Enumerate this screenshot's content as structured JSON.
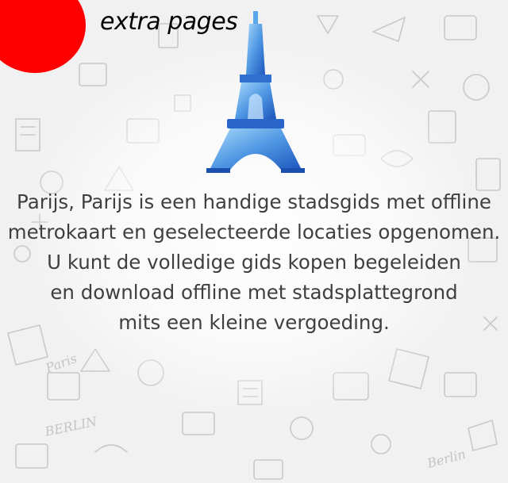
{
  "header": {
    "title": "extra pages"
  },
  "content": {
    "lines": [
      "Parijs, Parijs is een handige stadsgids met offline",
      "metrokaart en geselecteerde locaties opgenomen.",
      "U kunt de volledige gids kopen begeleiden",
      "en download offline met stadsplattegrond",
      "mits een kleine vergoeding."
    ]
  },
  "colors": {
    "badge": "#ff0000",
    "tower_light": "#8ec8f5",
    "tower_dark": "#1f5fc4",
    "text": "#3f3f3f"
  },
  "icons": {
    "hero": "eiffel-tower-icon",
    "background": "doodle-pattern"
  }
}
